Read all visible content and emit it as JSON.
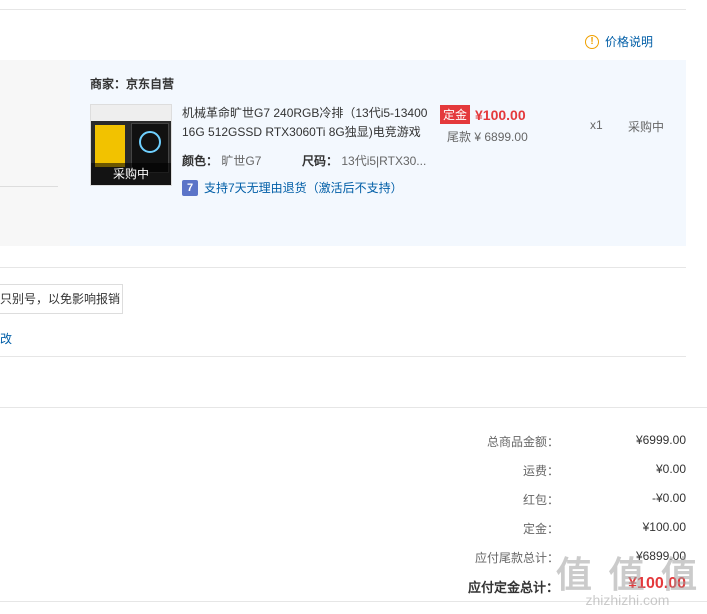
{
  "price_note": {
    "icon": "exclamation-circle-icon",
    "label": "价格说明"
  },
  "shop": {
    "seller_label": "商家：",
    "seller_name": "京东自营",
    "product": {
      "thumb_overlay": "采购中",
      "title": "机械革命旷世G7 240RGB冷排（13代i5-13400 16G 512GSSD RTX3060Ti 8G独显)电竞游戏",
      "color_label": "颜色：",
      "color_value": "旷世G7",
      "size_label": "尺码：",
      "size_value": "13代i5|RTX30...",
      "service_icon": "7",
      "service_text": "支持7天无理由退货（激活后不支持）",
      "deposit_tag": "定金",
      "deposit_amount": "¥100.00",
      "tail_label": "尾款 ¥",
      "tail_amount": "6899.00",
      "quantity": "x1",
      "status": "采购中"
    }
  },
  "invoice_tip": "只别号，以免影响报销",
  "edit_link": "改",
  "summary": {
    "rows": [
      {
        "label": "总商品金额：",
        "value": "¥6999.00"
      },
      {
        "label": "运费：",
        "value": "¥0.00"
      },
      {
        "label": "红包：",
        "value": "-¥0.00"
      },
      {
        "label": "定金：",
        "value": "¥100.00"
      },
      {
        "label": "应付尾款总计：",
        "value": "¥6899.00"
      }
    ],
    "total_label": "应付定金总计：",
    "total_value": "¥100.00"
  },
  "watermark": {
    "big": "值 值 值",
    "small": "zhizhizhi.com"
  },
  "colors": {
    "accent_red": "#e4393c",
    "link_blue": "#005ea7",
    "shop_bg": "#f3f8fe"
  }
}
